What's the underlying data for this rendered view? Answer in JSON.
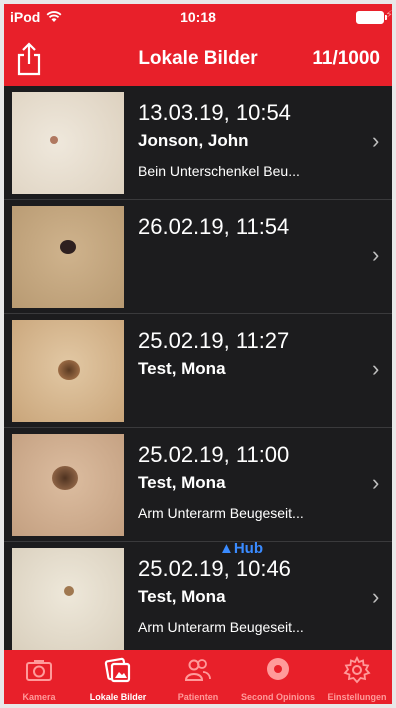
{
  "status": {
    "carrier": "iPod",
    "time": "10:18"
  },
  "nav": {
    "title": "Lokale Bilder",
    "count": "11/1000",
    "share_icon": "share-icon"
  },
  "rows": [
    {
      "date": "13.03.19, 10:54",
      "name": "Jonson, John",
      "location": "Bein Unterschenkel Beu...",
      "skin": "#e6ddd0",
      "spot": "#b07860"
    },
    {
      "date": "26.02.19, 11:54",
      "name": "",
      "location": "",
      "skin": "#cbb08a",
      "spot": "#2e2020"
    },
    {
      "date": "25.02.19, 11:27",
      "name": "Test, Mona",
      "location": "",
      "skin": "#dcbf98",
      "spot": "#7a5230"
    },
    {
      "date": "25.02.19, 11:00",
      "name": "Test, Mona",
      "location": "Arm Unterarm Beugeseit...",
      "skin": "#d6b597",
      "spot": "#6d4a32"
    },
    {
      "date": "25.02.19, 10:46",
      "name": "Test, Mona",
      "location": "Arm Unterarm Beugeseit...",
      "skin": "#e7e0d0",
      "spot": "#a07850",
      "badge": "▲Hub"
    }
  ],
  "tabs": [
    {
      "label": "Kamera",
      "icon": "camera-icon",
      "active": false
    },
    {
      "label": "Lokale Bilder",
      "icon": "photos-icon",
      "active": true
    },
    {
      "label": "Patienten",
      "icon": "patients-icon",
      "active": false
    },
    {
      "label": "Second Opinions",
      "icon": "second-opinion-icon",
      "active": false
    },
    {
      "label": "Einstellungen",
      "icon": "gear-icon",
      "active": false
    }
  ],
  "colors": {
    "brand_red": "#e8202a",
    "row_bg": "#1c1c1e",
    "hub_blue": "#3a8bff"
  }
}
